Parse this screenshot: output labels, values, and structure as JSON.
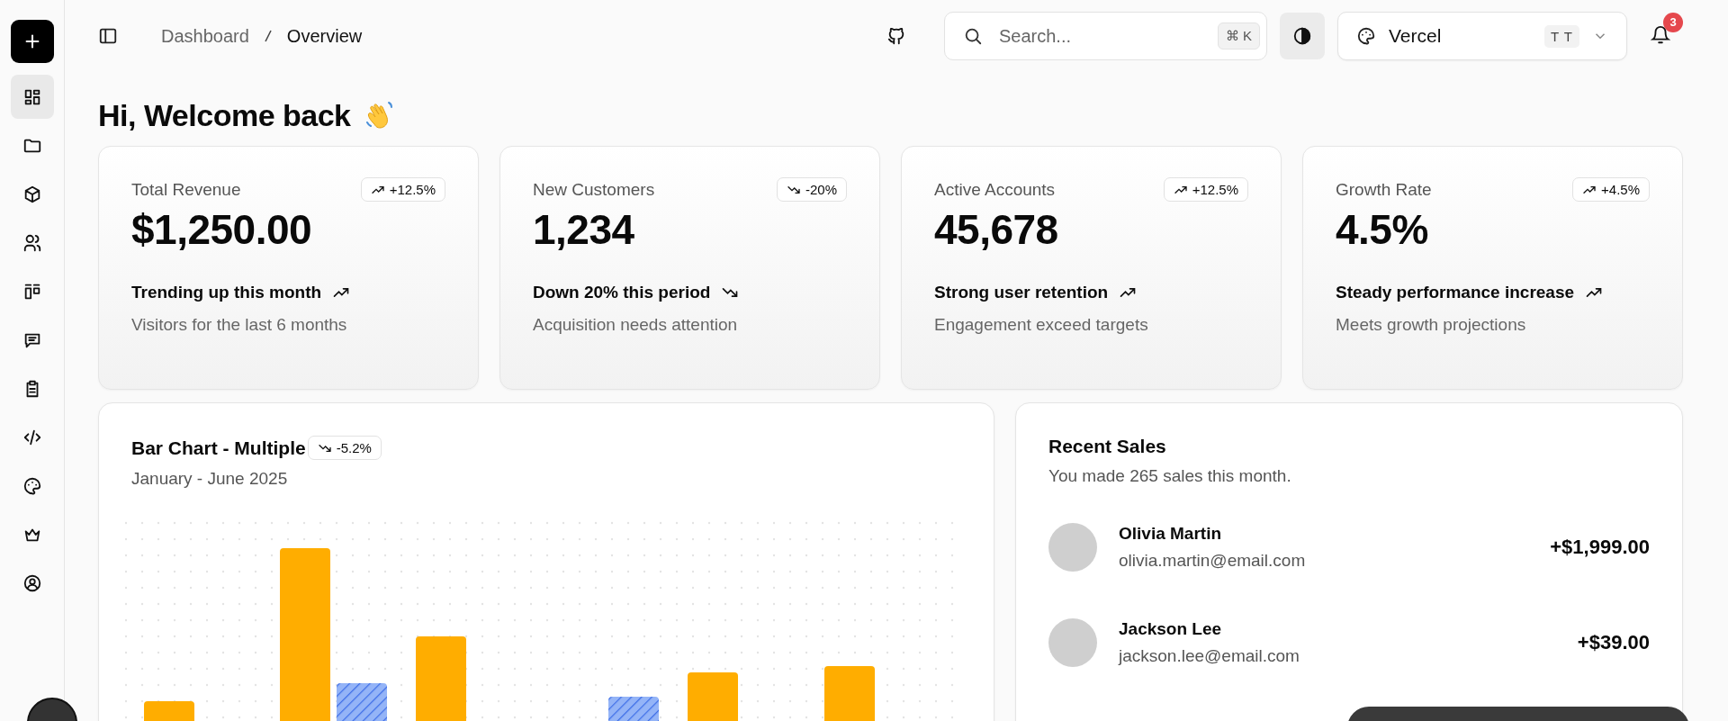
{
  "sidebar": {
    "items": [
      {
        "selected": true
      },
      {
        "selected": false
      },
      {
        "selected": false
      },
      {
        "selected": false
      },
      {
        "selected": false
      },
      {
        "selected": false
      },
      {
        "selected": false
      },
      {
        "selected": false
      },
      {
        "selected": false
      },
      {
        "selected": false
      },
      {
        "selected": false
      }
    ]
  },
  "breadcrumb": [
    "Dashboard",
    "Overview"
  ],
  "search": {
    "placeholder": "Search...",
    "shortcut": [
      "⌘",
      "K"
    ]
  },
  "theme_select": {
    "value": "Vercel",
    "initials": "T T"
  },
  "notifications": {
    "count": "3"
  },
  "greeting": "Hi, Welcome back",
  "stats": [
    {
      "label": "Total Revenue",
      "badge": "+12.5%",
      "kind": "up",
      "value": "$1,250.00",
      "headline": "Trending up this month",
      "note": "Visitors for the last 6 months"
    },
    {
      "label": "New Customers",
      "badge": "-20%",
      "kind": "down",
      "value": "1,234",
      "headline": "Down 20% this period",
      "note": "Acquisition needs attention"
    },
    {
      "label": "Active Accounts",
      "badge": "+12.5%",
      "kind": "up",
      "value": "45,678",
      "headline": "Strong user retention",
      "note": "Engagement exceed targets"
    },
    {
      "label": "Growth Rate",
      "badge": "+4.5%",
      "kind": "up",
      "value": "4.5%",
      "headline": "Steady performance increase",
      "note": "Meets growth projections"
    }
  ],
  "bar_chart": {
    "title": "Bar Chart - Multiple",
    "badge": "-5.2%",
    "kind": "down",
    "subtitle": "January - June 2025"
  },
  "recent_sales": {
    "title": "Recent Sales",
    "subtitle": "You made 265 sales this month.",
    "rows": [
      {
        "name": "Olivia Martin",
        "email": "olivia.martin@email.com",
        "amount": "+$1,999.00"
      },
      {
        "name": "Jackson Lee",
        "email": "jackson.lee@email.com",
        "amount": "+$39.00"
      }
    ]
  }
}
